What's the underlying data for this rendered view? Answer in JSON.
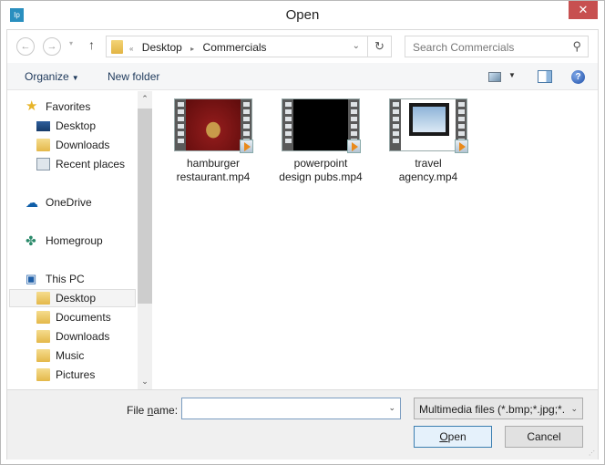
{
  "window": {
    "title": "Open",
    "app_icon": "Ip",
    "close_label": "✕"
  },
  "navigation": {
    "back_icon": "←",
    "forward_icon": "→",
    "recent_icon": "▾",
    "up_icon": "↑",
    "breadcrumb": [
      "Desktop",
      "Commercials"
    ],
    "breadcrumb_prefix": "«",
    "breadcrumb_separator": "▸",
    "address_dropdown": "⌄",
    "refresh_icon": "↻",
    "search_placeholder": "Search Commercials",
    "search_icon": "⚲"
  },
  "toolbar": {
    "organize_label": "Organize",
    "new_folder_label": "New folder",
    "help_label": "?",
    "dropdown_glyph": "▼"
  },
  "sidebar": {
    "items": [
      {
        "label": "Favorites",
        "icon": "star-icon",
        "level": 0
      },
      {
        "label": "Desktop",
        "icon": "desktop-icon",
        "level": 1
      },
      {
        "label": "Downloads",
        "icon": "downloads-folder-icon",
        "level": 1
      },
      {
        "label": "Recent places",
        "icon": "recent-places-icon",
        "level": 1
      },
      {
        "label": "OneDrive",
        "icon": "onedrive-icon",
        "level": 0
      },
      {
        "label": "Homegroup",
        "icon": "homegroup-icon",
        "level": 0
      },
      {
        "label": "This PC",
        "icon": "this-pc-icon",
        "level": 0
      },
      {
        "label": "Desktop",
        "icon": "desktop-folder-icon",
        "level": 1,
        "selected": true
      },
      {
        "label": "Documents",
        "icon": "documents-folder-icon",
        "level": 1
      },
      {
        "label": "Downloads",
        "icon": "downloads-folder-icon",
        "level": 1
      },
      {
        "label": "Music",
        "icon": "music-folder-icon",
        "level": 1
      },
      {
        "label": "Pictures",
        "icon": "pictures-folder-icon",
        "level": 1
      }
    ],
    "scroll_up": "⌃",
    "scroll_down": "⌄"
  },
  "files": [
    {
      "line1": "hamburger",
      "line2": "restaurant.mp4",
      "thumb": "hamburger"
    },
    {
      "line1": "powerpoint",
      "line2": "design pubs.mp4",
      "thumb": "black"
    },
    {
      "line1": "travel",
      "line2": "agency.mp4",
      "thumb": "travel"
    }
  ],
  "footer": {
    "file_name_label_pre": "File ",
    "file_name_label_ul": "n",
    "file_name_label_post": "ame:",
    "file_name_value": "",
    "file_type": "Multimedia files (*.bmp;*.jpg;*.",
    "open_ul": "O",
    "open_rest": "pen",
    "cancel_label": "Cancel",
    "dropdown_glyph": "⌄"
  }
}
